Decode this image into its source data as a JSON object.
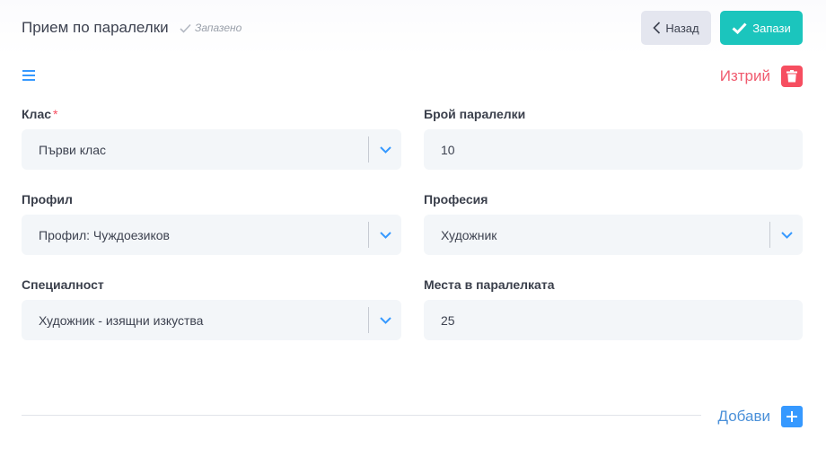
{
  "header": {
    "title": "Прием по паралелки",
    "saved_status": "Запазено",
    "back_label": "Назад",
    "save_label": "Запази"
  },
  "toolbar": {
    "menu_icon": "hamburger-menu-icon",
    "delete_label": "Изтрий",
    "delete_icon": "trash-icon"
  },
  "form": {
    "class_label": "Клас",
    "class_required": "*",
    "class_value": "Първи клас",
    "parallels_count_label": "Брой паралелки",
    "parallels_count_value": "10",
    "profile_label": "Профил",
    "profile_value": "Профил: Чуждоезиков",
    "profession_label": "Професия",
    "profession_value": "Художник",
    "specialty_label": "Специалност",
    "specialty_value": "Художник - изящни изкуства",
    "seats_label": "Места в паралелката",
    "seats_value": "25"
  },
  "footer": {
    "add_label": "Добави",
    "add_icon": "plus-icon"
  },
  "colors": {
    "save_button": "#1bc5bd",
    "back_button": "#e4e6ef",
    "delete": "#f64e60",
    "add": "#3699ff",
    "field_bg": "#f3f6f9",
    "chevron": "#3699ff"
  }
}
